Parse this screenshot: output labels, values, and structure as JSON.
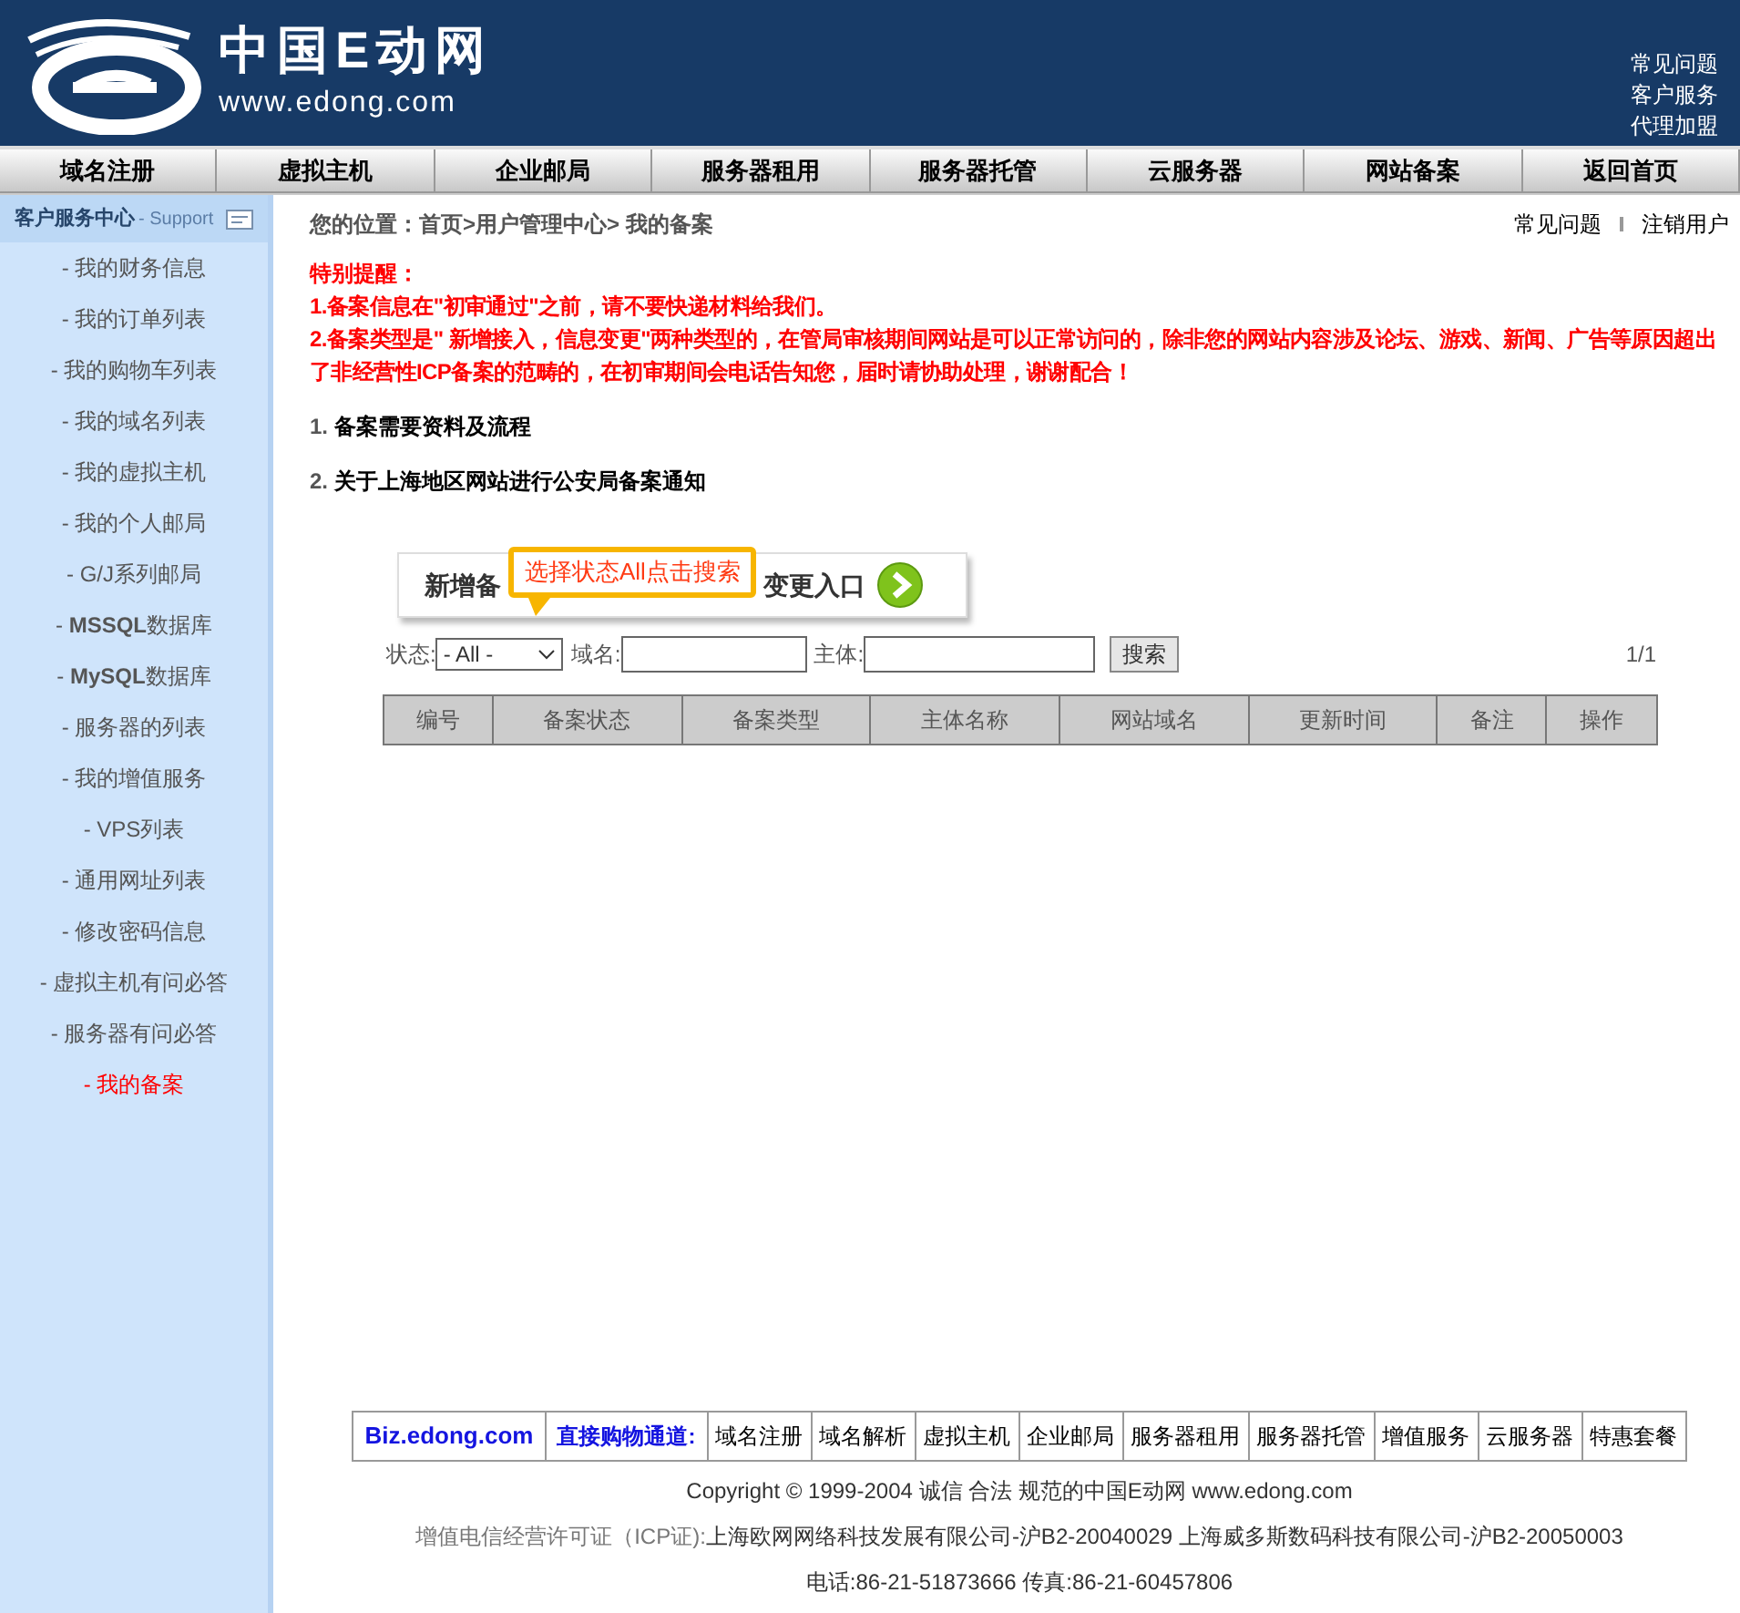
{
  "header": {
    "logo_title": "中国E动网",
    "logo_url": "www.edong.com",
    "links": [
      "常见问题",
      "客户服务",
      "代理加盟"
    ]
  },
  "nav": [
    "域名注册",
    "虚拟主机",
    "企业邮局",
    "服务器租用",
    "服务器托管",
    "云服务器",
    "网站备案",
    "返回首页"
  ],
  "sidebar": {
    "title": "客户服务中心",
    "subtitle": "- Support",
    "items": [
      {
        "label": "- 我的财务信息",
        "selected": false
      },
      {
        "label": "- 我的订单列表",
        "selected": false
      },
      {
        "label": "- 我的购物车列表",
        "selected": false
      },
      {
        "label": "- 我的域名列表",
        "selected": false
      },
      {
        "label": "- 我的虚拟主机",
        "selected": false
      },
      {
        "label": "- 我的个人邮局",
        "selected": false
      },
      {
        "label": "- G/J系列邮局",
        "selected": false
      },
      {
        "label": "- **MSSQL**数据库",
        "selected": false
      },
      {
        "label": "- **MySQL**数据库",
        "selected": false
      },
      {
        "label": "- 服务器的列表",
        "selected": false
      },
      {
        "label": "- 我的增值服务",
        "selected": false
      },
      {
        "label": "- VPS列表",
        "selected": false
      },
      {
        "label": "- 通用网址列表",
        "selected": false
      },
      {
        "label": "- 修改密码信息",
        "selected": false
      },
      {
        "label": "- 虚拟主机有问必答",
        "selected": false
      },
      {
        "label": "- 服务器有问必答",
        "selected": false
      },
      {
        "label": "- 我的备案",
        "selected": true
      }
    ]
  },
  "breadcrumb": "您的位置：**首页>用户管理中心>** 我的备案",
  "top_links": [
    "常见问题",
    "注销用户"
  ],
  "notice": {
    "title": "特别提醒：",
    "lines": [
      "1.备案信息在\"初审通过\"之前，请不要快递材料给我们。",
      "2.备案类型是\" 新增接入，信息变更\"两种类型的，在管局审核期间网站是可以正常访问的，除非您的网站内容涉及论坛、游戏、新闻、广告等原因超出了非经营性ICP备案的范畴的，在初审期间会电话告知您，届时请协助处理，谢谢配合！"
    ]
  },
  "info_links": [
    {
      "num": "1.",
      "label": "备案需要资料及流程"
    },
    {
      "num": "2.",
      "label": "关于上海地区网站进行公安局备案通知"
    }
  ],
  "banner": {
    "left": "新增备",
    "right": "变更入口"
  },
  "tooltip": "选择状态All点击搜索",
  "search": {
    "status_label": "状态:",
    "status_value": "- All -",
    "domain_label": "域名:",
    "owner_label": "主体:",
    "button": "搜索",
    "pager": "1/1"
  },
  "table": {
    "columns": [
      "编号",
      "备案状态",
      "备案类型",
      "主体名称",
      "网站域名",
      "更新时间",
      "备注",
      "操作"
    ]
  },
  "footer": {
    "brand": "Biz.edong.com",
    "channel": "直接购物通道:",
    "links": [
      "域名注册",
      "域名解析",
      "虚拟主机",
      "企业邮局",
      "服务器租用",
      "服务器托管",
      "增值服务",
      "云服务器",
      "特惠套餐"
    ],
    "copyright": "Copyright © 1999-2004 诚信 合法 规范的中国E动网 www.edong.com",
    "license_label": "增值电信经营许可证（ICP证):",
    "license": "上海欧网网络科技发展有限公司-沪B2-20040029 上海威多斯数码科技有限公司-沪B2-20050003",
    "contact": "电话:86-21-51873666 传真:86-21-60457806"
  }
}
